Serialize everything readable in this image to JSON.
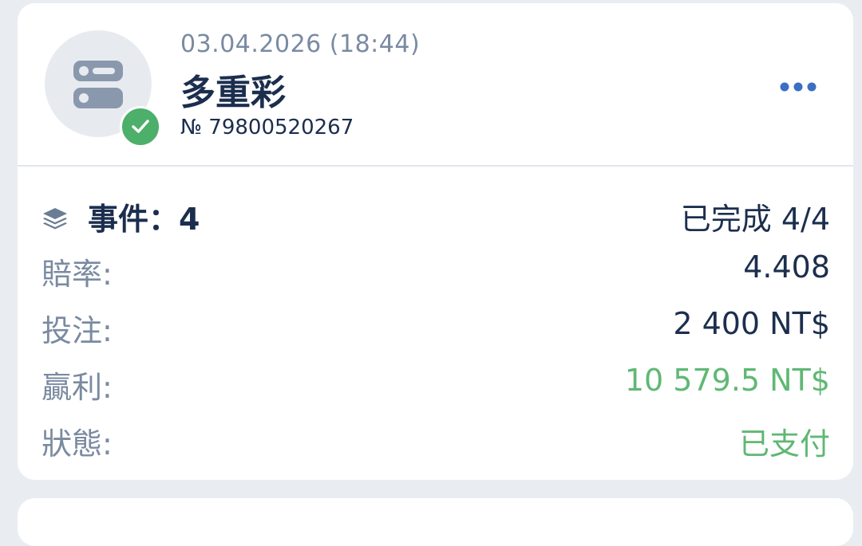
{
  "ticket": {
    "date": "03.04.2026 (18:44)",
    "title": "多重彩",
    "number": "№ 79800520267",
    "status_icon": "check-icon",
    "type_icon": "list-toggle-icon",
    "menu_icon": "more-horizontal-icon"
  },
  "events": {
    "label": "事件：",
    "count": "4",
    "completed_label": "已完成",
    "completed_value": "4/4",
    "icon": "layers-icon"
  },
  "details": {
    "odds_label": "賠率:",
    "odds_value": "4.408",
    "stake_label": "投注:",
    "stake_value": "2 400 NT$",
    "win_label": "贏利:",
    "win_value": "10 579.5 NT$",
    "status_label": "狀態:",
    "status_value": "已支付"
  },
  "colors": {
    "primary_text": "#1c2e4e",
    "secondary_text": "#7a8aa1",
    "success": "#5fb874",
    "badge": "#4caf6a",
    "background": "#e9edf2"
  }
}
